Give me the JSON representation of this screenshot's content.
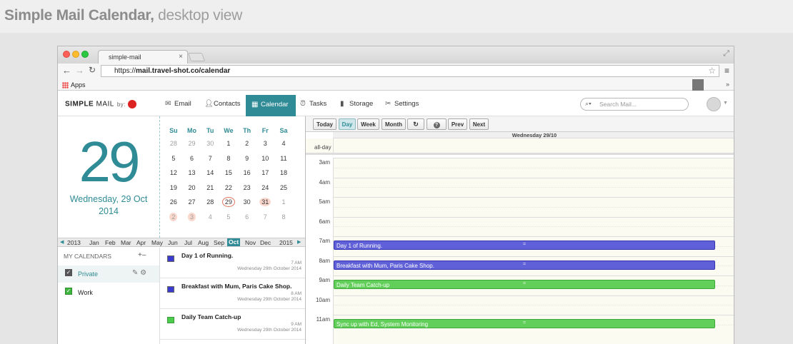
{
  "banner": {
    "title_bold": "Simple Mail Calendar,",
    "title_rest": " desktop view"
  },
  "browser": {
    "tab_title": "simple-mail",
    "url_prefix": "https://",
    "url_rest": "mail.travel-shot.co/calendar",
    "bookmark_apps": "Apps"
  },
  "app": {
    "logo_bold": "SIMPLE",
    "logo_rest": " MAIL",
    "logo_by": "by:",
    "nav": [
      {
        "label": "Email",
        "icon": "envelope-icon"
      },
      {
        "label": "Contacts",
        "icon": "person-icon"
      },
      {
        "label": "Calendar",
        "icon": "calendar-icon"
      },
      {
        "label": "Tasks",
        "icon": "alarm-icon"
      },
      {
        "label": "Storage",
        "icon": "file-icon"
      },
      {
        "label": "Settings",
        "icon": "tools-icon"
      }
    ],
    "search_placeholder": "Search Mail...",
    "accent": "#2f8b95"
  },
  "bigdate": {
    "day": "29",
    "line1": "Wednesday, 29 Oct",
    "line2": "2014"
  },
  "minical": {
    "headers": [
      "Su",
      "Mo",
      "Tu",
      "We",
      "Th",
      "Fr",
      "Sa"
    ],
    "weeks": [
      [
        "28",
        "29",
        "30",
        "1",
        "2",
        "3",
        "4"
      ],
      [
        "5",
        "6",
        "7",
        "8",
        "9",
        "10",
        "11"
      ],
      [
        "12",
        "13",
        "14",
        "15",
        "16",
        "17",
        "18"
      ],
      [
        "19",
        "20",
        "21",
        "22",
        "23",
        "24",
        "25"
      ],
      [
        "26",
        "27",
        "28",
        "29",
        "30",
        "31",
        "1"
      ],
      [
        "2",
        "3",
        "4",
        "5",
        "6",
        "7",
        "8"
      ]
    ]
  },
  "monthbar": {
    "prev_year": "2013",
    "months": [
      "Jan",
      "Feb",
      "Mar",
      "Apr",
      "May",
      "Jun",
      "Jul",
      "Aug",
      "Sep",
      "Oct",
      "Nov",
      "Dec"
    ],
    "selected": "Oct",
    "next_year": "2015"
  },
  "calendars": {
    "header": "MY CALENDARS",
    "add": "+",
    "remove": "–",
    "items": [
      {
        "name": "Private",
        "color": "#555555",
        "selected": true
      },
      {
        "name": "Work",
        "color": "#3fb53f",
        "selected": false
      }
    ]
  },
  "event_list": [
    {
      "title": "Day 1 of Running.",
      "time": "7 AM",
      "date": "Wednesday 29th October 2014",
      "color": "#3a3acf"
    },
    {
      "title": "Breakfast with Mum, Paris Cake Shop.",
      "time": "8 AM",
      "date": "Wednesday 29th October 2014",
      "color": "#3a3acf"
    },
    {
      "title": "Daily Team Catch-up",
      "time": "9 AM",
      "date": "Wednesday 29th October 2014",
      "color": "#4ccc4c"
    }
  ],
  "toolbar": {
    "today": "Today",
    "day": "Day",
    "week": "Week",
    "month": "Month",
    "prev": "Prev",
    "next": "Next"
  },
  "dayview": {
    "header": "Wednesday 29/10",
    "allday": "all-day",
    "hours": [
      "3am",
      "4am",
      "5am",
      "6am",
      "7am",
      "8am",
      "9am",
      "10am",
      "11am"
    ],
    "events": [
      {
        "title": "Day 1 of Running.",
        "hour": 7,
        "color": "#6060d8"
      },
      {
        "title": "Breakfast with Mum, Paris Cake Shop.",
        "hour": 8,
        "color": "#6060d8"
      },
      {
        "title": "Daily Team Catch-up",
        "hour": 9,
        "color": "#62cf5a"
      },
      {
        "title": "Sync up with Ed, System Monitoring",
        "hour": 11,
        "color": "#62cf5a"
      }
    ]
  }
}
